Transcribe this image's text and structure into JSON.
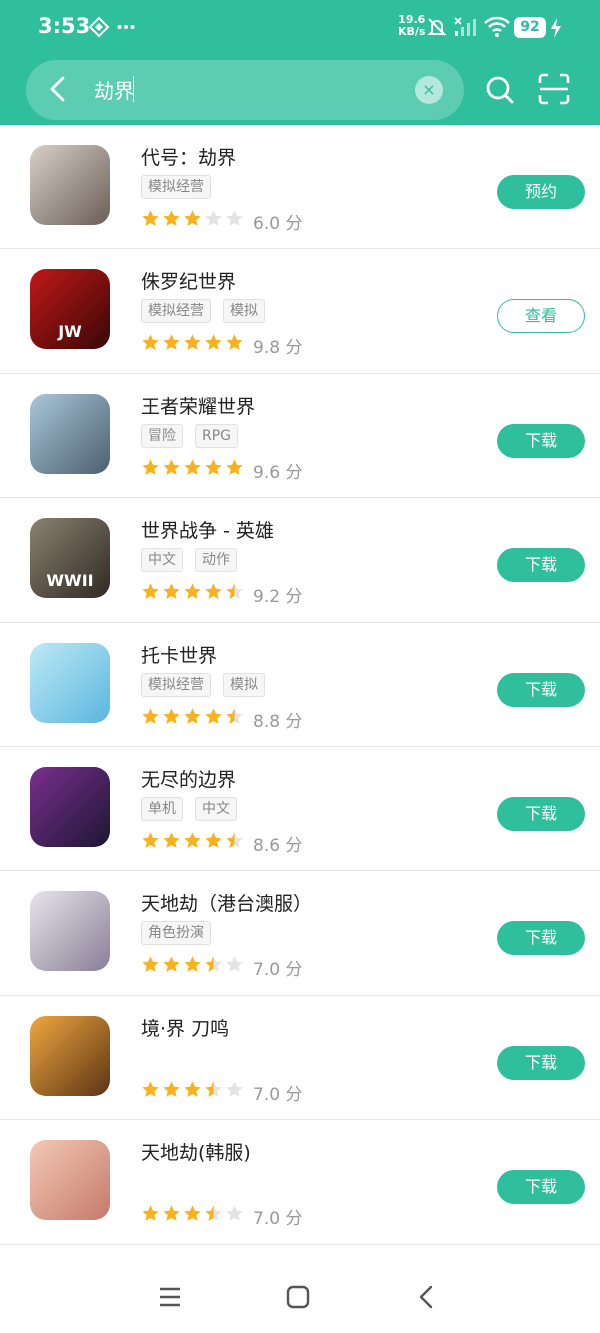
{
  "status_bar": {
    "time": "3:53",
    "network_speed_value": "19.6",
    "network_speed_unit": "KB/s",
    "battery": "92",
    "icons": [
      "nfc-icon",
      "more-dots-icon",
      "mute-bell-icon",
      "signal-icon",
      "wifi-icon",
      "battery-icon",
      "charging-icon"
    ]
  },
  "search": {
    "query": "劫界",
    "icons": [
      "back-arrow-icon",
      "clear-icon",
      "search-icon",
      "scan-icon"
    ]
  },
  "colors": {
    "accent": "#2fbf9d",
    "star_filled": "#f7b21e",
    "star_empty": "#e3e3e3"
  },
  "apps": [
    {
      "name": "代号：劫界",
      "tags": [
        "模拟经营"
      ],
      "rating": 3,
      "score": "6.0 分",
      "action": "预约",
      "action_style": "filled",
      "icon_colors": [
        "#d7d0c8",
        "#6b5d57"
      ],
      "icon_label": ""
    },
    {
      "name": "侏罗纪世界",
      "tags": [
        "模拟经营",
        "模拟"
      ],
      "rating": 5,
      "score": "9.8 分",
      "action": "查看",
      "action_style": "outline",
      "icon_colors": [
        "#c01818",
        "#3a0606"
      ],
      "icon_label": "JW"
    },
    {
      "name": "王者荣耀世界",
      "tags": [
        "冒险",
        "RPG"
      ],
      "rating": 5,
      "score": "9.6 分",
      "action": "下载",
      "action_style": "filled",
      "icon_colors": [
        "#a9c6d8",
        "#4a6070"
      ],
      "icon_label": ""
    },
    {
      "name": "世界战争 - 英雄",
      "tags": [
        "中文",
        "动作"
      ],
      "rating": 4.5,
      "score": "9.2 分",
      "action": "下载",
      "action_style": "filled",
      "icon_colors": [
        "#8b8170",
        "#2f2a24"
      ],
      "icon_label": "WWII"
    },
    {
      "name": "托卡世界",
      "tags": [
        "模拟经营",
        "模拟"
      ],
      "rating": 4.5,
      "score": "8.8 分",
      "action": "下载",
      "action_style": "filled",
      "icon_colors": [
        "#bfe9f4",
        "#5ab6e0"
      ],
      "icon_label": ""
    },
    {
      "name": "无尽的边界",
      "tags": [
        "单机",
        "中文"
      ],
      "rating": 4.5,
      "score": "8.6 分",
      "action": "下载",
      "action_style": "filled",
      "icon_colors": [
        "#7a2f8e",
        "#1d1633"
      ],
      "icon_label": ""
    },
    {
      "name": "天地劫（港台澳服）",
      "tags": [
        "角色扮演"
      ],
      "rating": 3.5,
      "score": "7.0 分",
      "action": "下载",
      "action_style": "filled",
      "icon_colors": [
        "#e6e4ea",
        "#8a7f95"
      ],
      "icon_label": ""
    },
    {
      "name": "境·界 刀鸣",
      "tags": [],
      "rating": 3.5,
      "score": "7.0 分",
      "action": "下载",
      "action_style": "filled",
      "icon_colors": [
        "#f0a640",
        "#5a3414"
      ],
      "icon_label": ""
    },
    {
      "name": "天地劫(韩服)",
      "tags": [],
      "rating": 3.5,
      "score": "7.0 分",
      "action": "下载",
      "action_style": "filled",
      "icon_colors": [
        "#f3c9b5",
        "#c57a6a"
      ],
      "icon_label": ""
    }
  ],
  "nav_bar": {
    "icons": [
      "menu-icon",
      "home-icon",
      "back-icon"
    ]
  }
}
